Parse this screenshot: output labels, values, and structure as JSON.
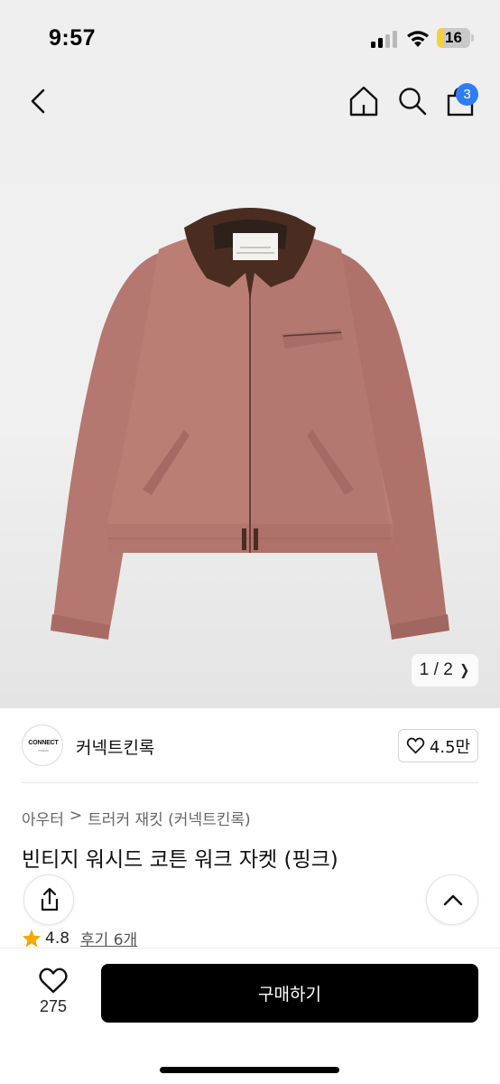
{
  "status_bar": {
    "time": "9:57",
    "battery_level": "16",
    "signal_bars_active": 2,
    "signal_bars_total": 4
  },
  "nav": {
    "icons": [
      "back-icon",
      "home-icon",
      "search-icon",
      "bag-icon"
    ],
    "cart_count": "3"
  },
  "gallery": {
    "page_indicator": "1 / 2",
    "image": "pink work jacket with brown corduroy collar",
    "jacket_color": "#b77a71",
    "collar_color": "#4a2d20"
  },
  "brand": {
    "logo_text": "CONNECT",
    "logo_subtext": "CINEMA",
    "name": "커넥트킨록",
    "like_count": "4.5만"
  },
  "product": {
    "breadcrumb": [
      "아우터",
      "트러커 재킷 (커넥트킨록)"
    ],
    "breadcrumb_separator": ">",
    "title": "빈티지 워시드 코튼 워크 자켓 (핑크)",
    "rating": "4.8",
    "review_link": "후기 6개"
  },
  "bottom_bar": {
    "wish_count": "275",
    "buy_label": "구매하기"
  },
  "colors": {
    "badge": "#2f7df6",
    "star": "#f2a900",
    "buy_button": "#000000"
  }
}
